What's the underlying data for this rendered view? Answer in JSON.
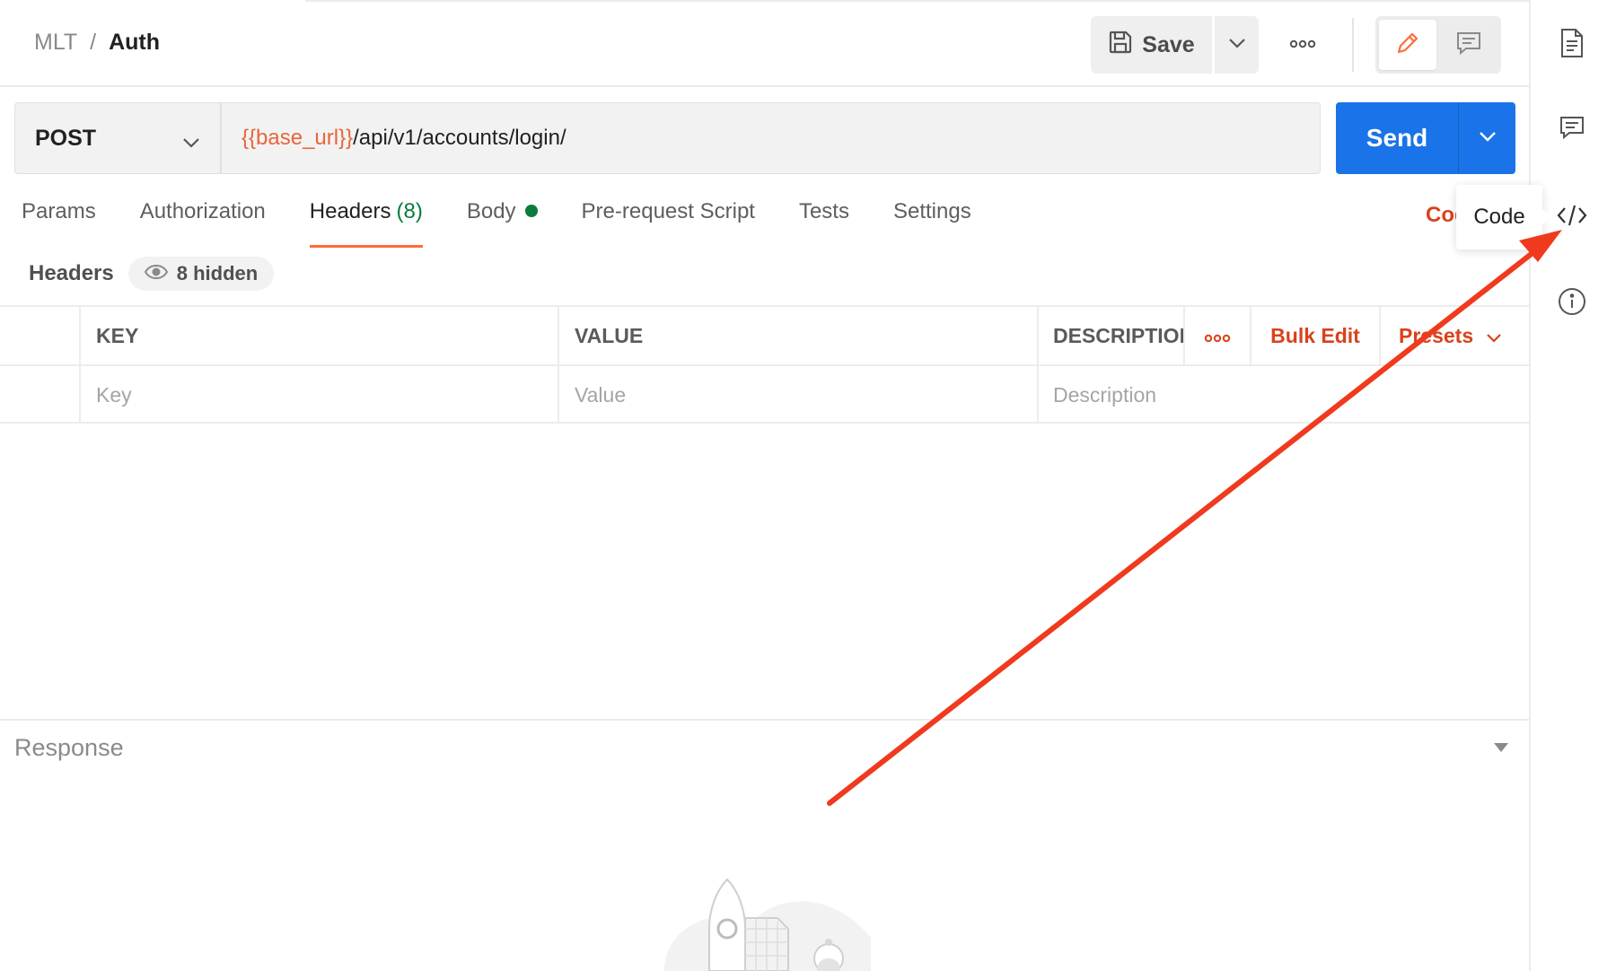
{
  "breadcrumb": {
    "parent": "MLT",
    "separator": "/",
    "current": "Auth"
  },
  "toolbar": {
    "save_label": "Save",
    "save_icon": "floppy-disk-icon",
    "more_icon": "more-horizontal-icon",
    "edit_mode_icon": "pencil-icon",
    "comment_mode_icon": "comment-icon"
  },
  "request": {
    "method": "POST",
    "url_variable": "{{base_url}}",
    "url_path": "/api/v1/accounts/login/",
    "send_label": "Send"
  },
  "tabs": [
    {
      "label": "Params"
    },
    {
      "label": "Authorization"
    },
    {
      "label": "Headers",
      "count": "(8)",
      "active": true
    },
    {
      "label": "Body",
      "has_content": true
    },
    {
      "label": "Pre-request Script"
    },
    {
      "label": "Tests"
    },
    {
      "label": "Settings"
    }
  ],
  "code_link_partial": "Code",
  "headers_panel": {
    "title": "Headers",
    "hidden_label": "8 hidden",
    "columns": {
      "key": "KEY",
      "value": "VALUE",
      "description": "DESCRIPTION",
      "bulk_edit": "Bulk Edit",
      "presets": "Presets"
    },
    "placeholders": {
      "key": "Key",
      "value": "Value",
      "description": "Description"
    }
  },
  "response": {
    "label": "Response"
  },
  "right_sidebar": {
    "icons": [
      "document-icon",
      "comment-icon",
      "code-icon",
      "info-icon"
    ]
  },
  "tooltip": {
    "label": "Code"
  },
  "colors": {
    "accent_orange": "#ff6c37",
    "link_red": "#d9421c",
    "send_blue": "#1a73e8",
    "variable_orange": "#e8663a",
    "status_green": "#0a7c3e",
    "annotation_red": "#f03a1e"
  }
}
